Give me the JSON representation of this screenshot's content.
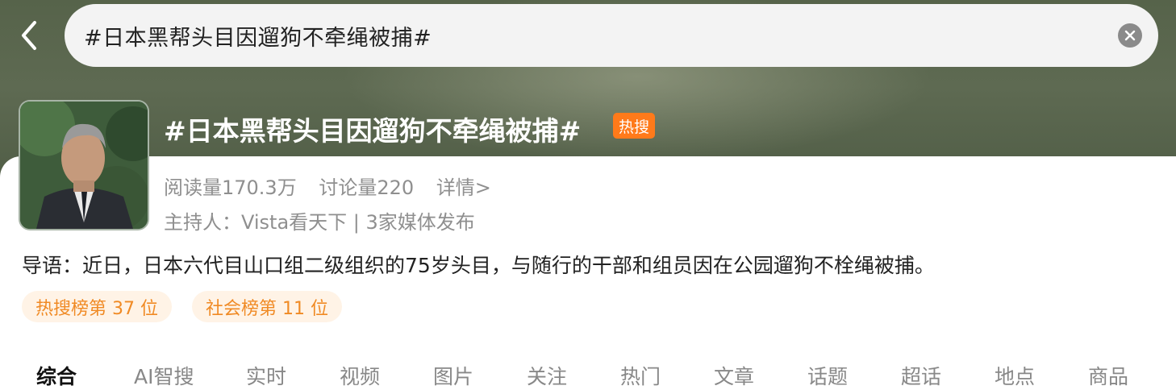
{
  "search": {
    "query": "#日本黑帮头目因遛狗不牵绳被捕#"
  },
  "topic": {
    "title": "#日本黑帮头目因遛狗不牵绳被捕#",
    "hot_badge": "热搜",
    "reads": "阅读量170.3万",
    "discussions": "讨论量220",
    "detail_link": "详情>",
    "host": "主持人：Vista看天下 | 3家媒体发布",
    "intro": "导语：近日，日本六代目山口组二级组织的75岁头目，与随行的干部和组员因在公园遛狗不栓绳被捕。",
    "tags": [
      "热搜榜第 37 位",
      "社会榜第 11 位"
    ]
  },
  "tabs": [
    "综合",
    "AI智搜",
    "实时",
    "视频",
    "图片",
    "关注",
    "热门",
    "文章",
    "话题",
    "超话",
    "地点",
    "商品"
  ],
  "colors": {
    "accent": "#ff7a1a",
    "tag_text": "#f08a24",
    "tag_bg": "#fff3e6"
  }
}
